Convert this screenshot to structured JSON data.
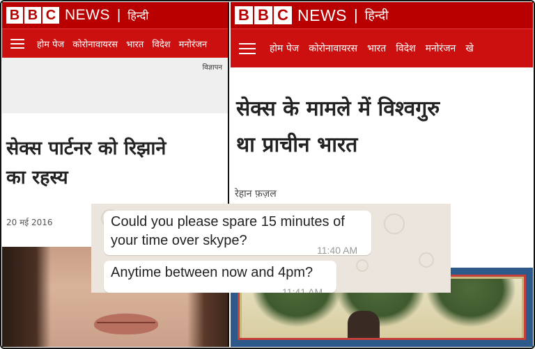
{
  "left_page": {
    "brand": {
      "bbc_letters": [
        "B",
        "B",
        "C"
      ],
      "news": "NEWS",
      "separator": "|",
      "language": "हिन्दी"
    },
    "nav": {
      "menu_icon": "hamburger-menu-icon",
      "items": [
        "होम पेज",
        "कोरोनावायरस",
        "भारत",
        "विदेश",
        "मनोरंजन"
      ]
    },
    "ad_label": "विज्ञापन",
    "headline_line1": "सेक्स पार्टनर को रिझाने",
    "headline_line2": "का रहस्य",
    "date": "20 मई 2016"
  },
  "right_page": {
    "brand": {
      "bbc_letters": [
        "B",
        "B",
        "C"
      ],
      "news": "NEWS",
      "separator": "|",
      "language": "हिन्दी"
    },
    "nav": {
      "menu_icon": "hamburger-menu-icon",
      "items": [
        "होम पेज",
        "कोरोनावायरस",
        "भारत",
        "विदेश",
        "मनोरंजन",
        "खे"
      ]
    },
    "headline_line1": "सेक्स के मामले में विश्वगुरु",
    "headline_line2": "था प्राचीन भारत",
    "author": "रेहान फ़ज़ल"
  },
  "chat": {
    "message1_line1": "Could you please spare 15 minutes of",
    "message1_line2": "your time over skype?",
    "message1_time": "11:40 AM",
    "message2": "Anytime between now and 4pm?",
    "message2_time": "11:41 AM"
  },
  "colors": {
    "bbc_red": "#b80000",
    "nav_red": "#cc1010",
    "chat_bg": "#ece5dd"
  }
}
